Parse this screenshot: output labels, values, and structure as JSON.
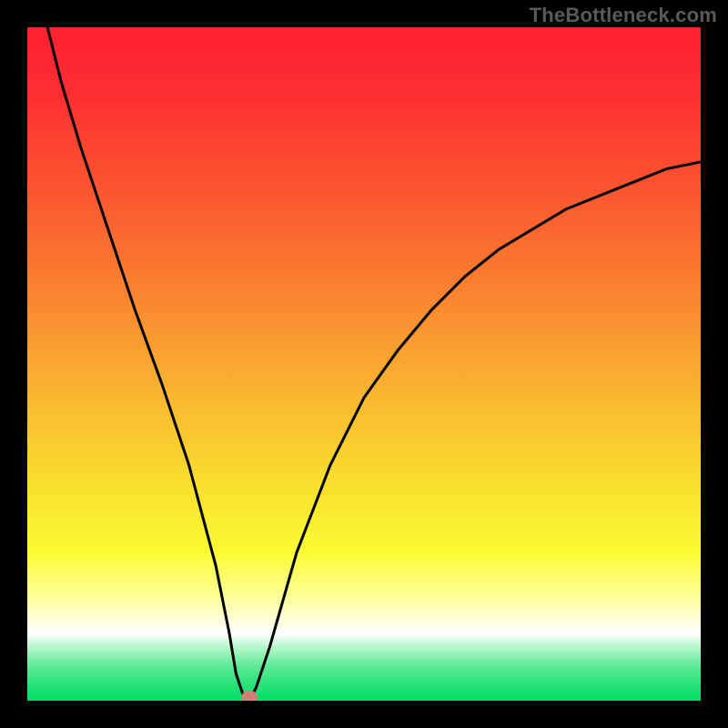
{
  "watermark": "TheBottleneck.com",
  "chart_data": {
    "type": "line",
    "title": "",
    "xlabel": "",
    "ylabel": "",
    "xlim": [
      0,
      100
    ],
    "ylim": [
      0,
      100
    ],
    "x": [
      3,
      5,
      8,
      12,
      16,
      20,
      24,
      28,
      30,
      31,
      32,
      33,
      34,
      36,
      40,
      45,
      50,
      55,
      60,
      65,
      70,
      75,
      80,
      85,
      90,
      95,
      100
    ],
    "y": [
      100,
      92,
      82,
      70,
      58,
      47,
      35,
      20,
      10,
      4,
      1,
      0,
      2,
      8,
      22,
      35,
      45,
      52,
      58,
      63,
      67,
      70,
      73,
      75,
      77,
      79,
      80
    ],
    "marker_point": {
      "x": 33,
      "y": 0
    },
    "gradient_bands": [
      {
        "pct": 0.0,
        "color": "#fd2032"
      },
      {
        "pct": 0.1,
        "color": "#fd2f31"
      },
      {
        "pct": 0.2,
        "color": "#fc4a30"
      },
      {
        "pct": 0.3,
        "color": "#fb6630"
      },
      {
        "pct": 0.4,
        "color": "#fa8530"
      },
      {
        "pct": 0.5,
        "color": "#f9a730"
      },
      {
        "pct": 0.6,
        "color": "#f9c72f"
      },
      {
        "pct": 0.7,
        "color": "#f9e52e"
      },
      {
        "pct": 0.78,
        "color": "#fbfb33"
      },
      {
        "pct": 0.85,
        "color": "#fdfea0"
      },
      {
        "pct": 0.9,
        "color": "#ffffff"
      },
      {
        "pct": 0.92,
        "color": "#b8f7cb"
      },
      {
        "pct": 0.95,
        "color": "#59e994"
      },
      {
        "pct": 1.0,
        "color": "#00dc62"
      }
    ]
  }
}
